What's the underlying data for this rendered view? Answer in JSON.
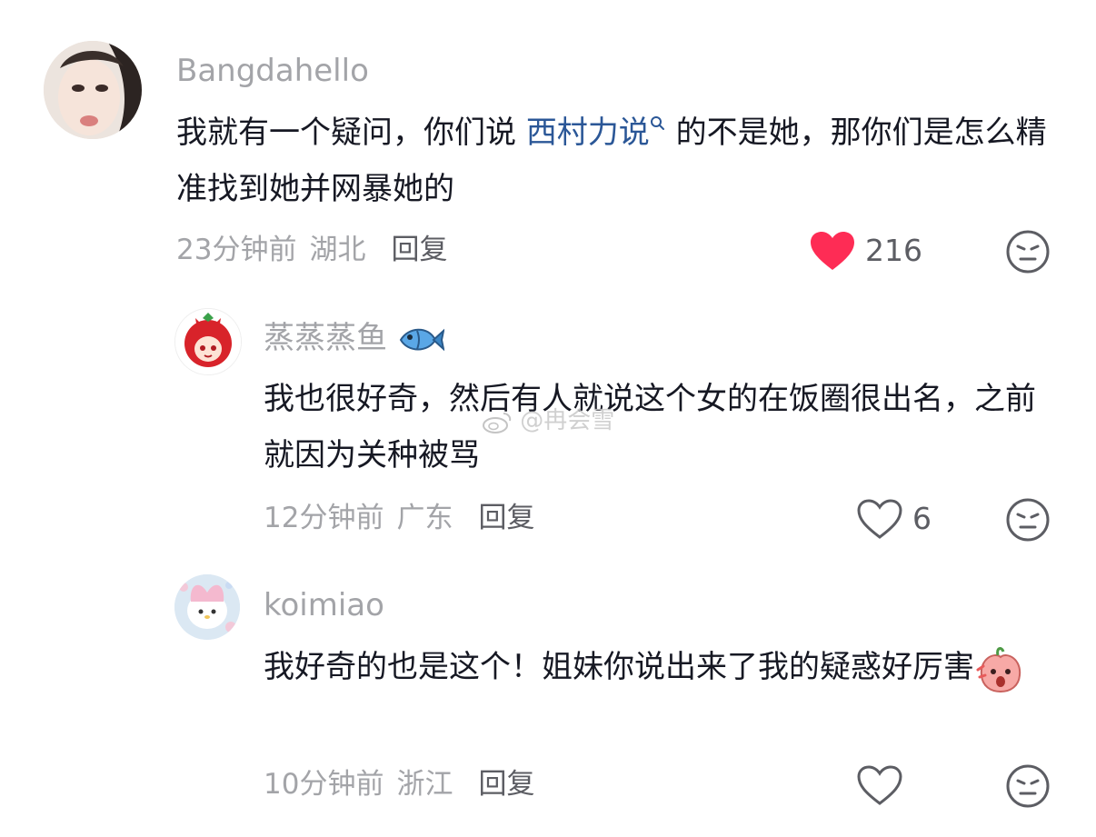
{
  "comments": [
    {
      "username": "Bangdahello",
      "text_prefix": "我就有一个疑问，你们说 ",
      "link_text": "西村力说",
      "text_suffix": " 的不是她，那你们是怎么精准找到她并网暴她的",
      "time": "23分钟前",
      "location": "湖北",
      "reply_label": "回复",
      "likes": "216",
      "liked": true
    },
    {
      "username": "蒸蒸蒸鱼",
      "username_emoji_icon": "fish-icon",
      "text": "我也很好奇，然后有人就说这个女的在饭圈很出名，之前就因为关种被骂",
      "time": "12分钟前",
      "location": "广东",
      "reply_label": "回复",
      "likes": "6",
      "liked": false
    },
    {
      "username": "koimiao",
      "text": "我好奇的也是这个！姐妹你说出来了我的疑惑好厉害",
      "text_emoji_icon": "surprised-peach-icon",
      "time": "10分钟前",
      "location": "浙江",
      "reply_label": "回复",
      "likes": "",
      "liked": false
    }
  ],
  "watermark": "@冉会雪",
  "colors": {
    "like_active": "#fe2c55",
    "link": "#2b5797",
    "meta": "#a3a4a8"
  }
}
